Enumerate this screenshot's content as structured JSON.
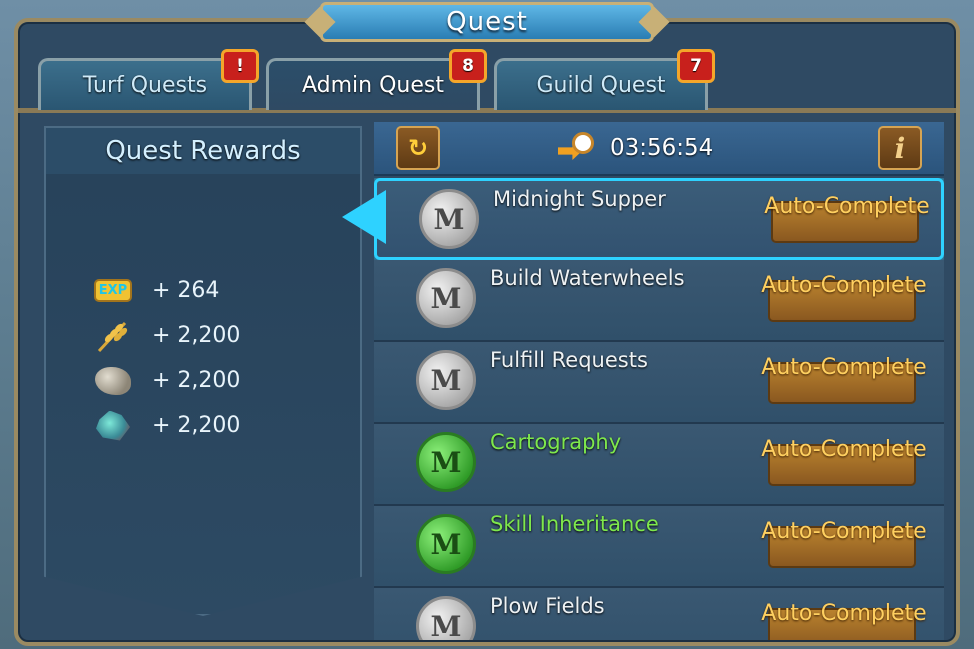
{
  "window": {
    "title": "Quest"
  },
  "tabs": [
    {
      "label": "Turf Quests",
      "badge": "!"
    },
    {
      "label": "Admin Quest",
      "badge": "8"
    },
    {
      "label": "Guild Quest",
      "badge": "7"
    }
  ],
  "rewards": {
    "header": "Quest Rewards",
    "items": [
      {
        "icon": "exp-icon",
        "icon_text": "EXP",
        "amount": "+ 264"
      },
      {
        "icon": "wheat-icon",
        "amount": "+ 2,200"
      },
      {
        "icon": "stone-icon",
        "amount": "+ 2,200"
      },
      {
        "icon": "ore-icon",
        "amount": "+ 2,200"
      }
    ]
  },
  "panel": {
    "timer": "03:56:54",
    "refresh_icon": "refresh-icon",
    "info_label": "i"
  },
  "quests": [
    {
      "name": "Midnight Supper",
      "seal": "grey",
      "seal_letter": "M",
      "button": "Auto-Complete"
    },
    {
      "name": "Build Waterwheels",
      "seal": "grey",
      "seal_letter": "M",
      "button": "Auto-Complete"
    },
    {
      "name": "Fulfill Requests",
      "seal": "grey",
      "seal_letter": "M",
      "button": "Auto-Complete"
    },
    {
      "name": "Cartography",
      "seal": "green",
      "seal_letter": "M",
      "button": "Auto-Complete"
    },
    {
      "name": "Skill Inheritance",
      "seal": "green",
      "seal_letter": "M",
      "button": "Auto-Complete"
    },
    {
      "name": "Plow Fields",
      "seal": "grey",
      "seal_letter": "M",
      "button": "Auto-Complete"
    }
  ],
  "colors": {
    "accent": "#2ed2ff",
    "done_text": "#7ee84c",
    "button_text": "#ffd060",
    "badge": "#c8201c"
  }
}
